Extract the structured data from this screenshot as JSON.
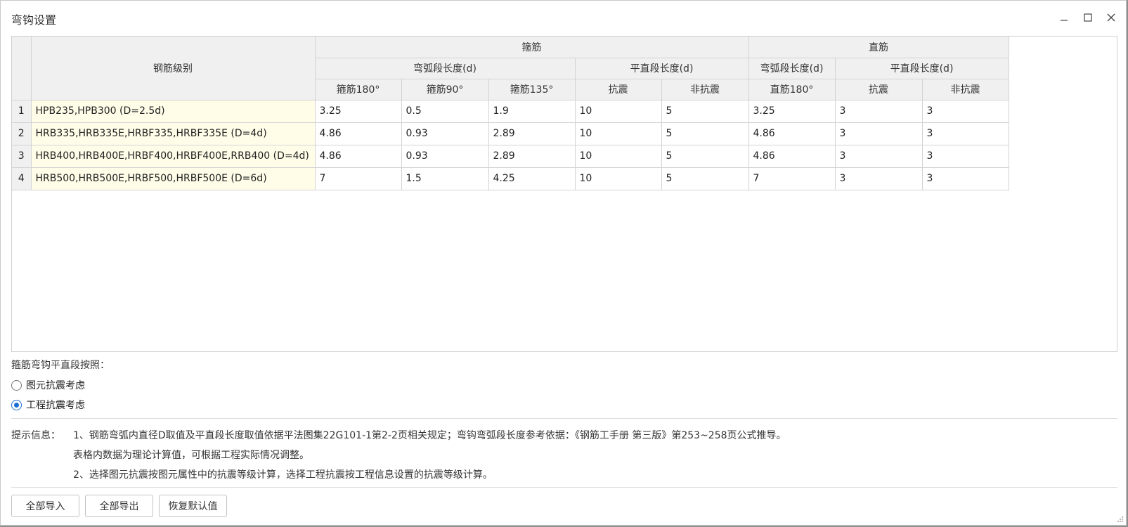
{
  "window": {
    "title": "弯钩设置"
  },
  "table": {
    "header": {
      "grade": "钢筋级别",
      "stirrup": "箍筋",
      "straight": "直筋",
      "arc_length": "弯弧段长度(d)",
      "flat_length": "平直段长度(d)",
      "straight_arc_length": "弯弧段长度(d)",
      "straight_flat_length": "平直段长度(d)",
      "cols": [
        "箍筋180°",
        "箍筋90°",
        "箍筋135°",
        "抗震",
        "非抗震",
        "直筋180°",
        "抗震",
        "非抗震"
      ]
    },
    "rows": [
      {
        "num": "1",
        "grade": "HPB235,HPB300 (D=2.5d)",
        "values": [
          "3.25",
          "0.5",
          "1.9",
          "10",
          "5",
          "3.25",
          "3",
          "3"
        ]
      },
      {
        "num": "2",
        "grade": "HRB335,HRB335E,HRBF335,HRBF335E (D=4d)",
        "values": [
          "4.86",
          "0.93",
          "2.89",
          "10",
          "5",
          "4.86",
          "3",
          "3"
        ]
      },
      {
        "num": "3",
        "grade": "HRB400,HRB400E,HRBF400,HRBF400E,RRB400 (D=4d)",
        "values": [
          "4.86",
          "0.93",
          "2.89",
          "10",
          "5",
          "4.86",
          "3",
          "3"
        ]
      },
      {
        "num": "4",
        "grade": "HRB500,HRB500E,HRBF500,HRBF500E (D=6d)",
        "values": [
          "7",
          "1.5",
          "4.25",
          "10",
          "5",
          "7",
          "3",
          "3"
        ]
      }
    ]
  },
  "radio": {
    "title": "箍筋弯钩平直段按照：",
    "options": [
      {
        "label": "图元抗震考虑",
        "checked": false
      },
      {
        "label": "工程抗震考虑",
        "checked": true
      }
    ]
  },
  "hint": {
    "label": "提示信息：",
    "line1": "1、钢筋弯弧内直径D取值及平直段长度取值依据平法图集22G101-1第2-2页相关规定；弯钩弯弧段长度参考依据：《钢筋工手册 第三版》第253~258页公式推导。",
    "line2": "表格内数据为理论计算值，可根据工程实际情况调整。",
    "line3": "2、选择图元抗震按图元属性中的抗震等级计算，选择工程抗震按工程信息设置的抗震等级计算。"
  },
  "buttons": {
    "import": "全部导入",
    "export": "全部导出",
    "restore": "恢复默认值"
  },
  "colors": {
    "accent": "#1b6ed1",
    "grade_cell_bg": "#fffde8",
    "header_bg": "#f0f0f0"
  }
}
